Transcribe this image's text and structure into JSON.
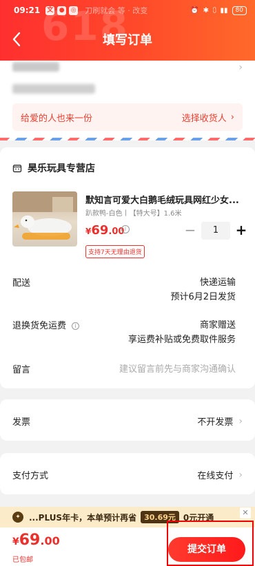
{
  "status": {
    "time": "09:21",
    "notice": "刀刷就会 等 · 改变",
    "battery": "80"
  },
  "header": {
    "title": "填写订单",
    "deco": "618"
  },
  "gift": {
    "left": "给爱的人也来一份",
    "right": "选择收货人"
  },
  "shop": {
    "name": "昊乐玩具专营店",
    "product": {
      "title": "默知言可爱大白鹅毛绒玩具网红少女...",
      "spec": "趴款鸭-白色丨【特大号】1.6米",
      "price_symbol": "¥",
      "price_int": "69",
      "price_dec": ".00",
      "quantity": "1",
      "guarantee": "支持7天无理由退货"
    },
    "delivery": {
      "label": "配送",
      "value1": "快递运输",
      "value2": "预计6月2日发货"
    },
    "return": {
      "label": "退换货免运费",
      "value1": "商家赠送",
      "value2": "享运费补贴或免费取件服务"
    },
    "message": {
      "label": "留言",
      "placeholder": "建议留言前先与商家沟通确认"
    }
  },
  "invoice": {
    "label": "发票",
    "value": "不开发票"
  },
  "payment": {
    "label": "支付方式",
    "value": "在线支付"
  },
  "plus_banner": {
    "text": "...PLUS年卡，本单预计再省",
    "save": "30.69元",
    "open": "0元开通"
  },
  "footer": {
    "price_symbol": "¥",
    "price_int": "69",
    "price_dec": ".00",
    "shipping": "已包邮",
    "submit": "提交订单"
  },
  "colors": {
    "accent": "#e9302d",
    "header": "#ff3a2f"
  }
}
